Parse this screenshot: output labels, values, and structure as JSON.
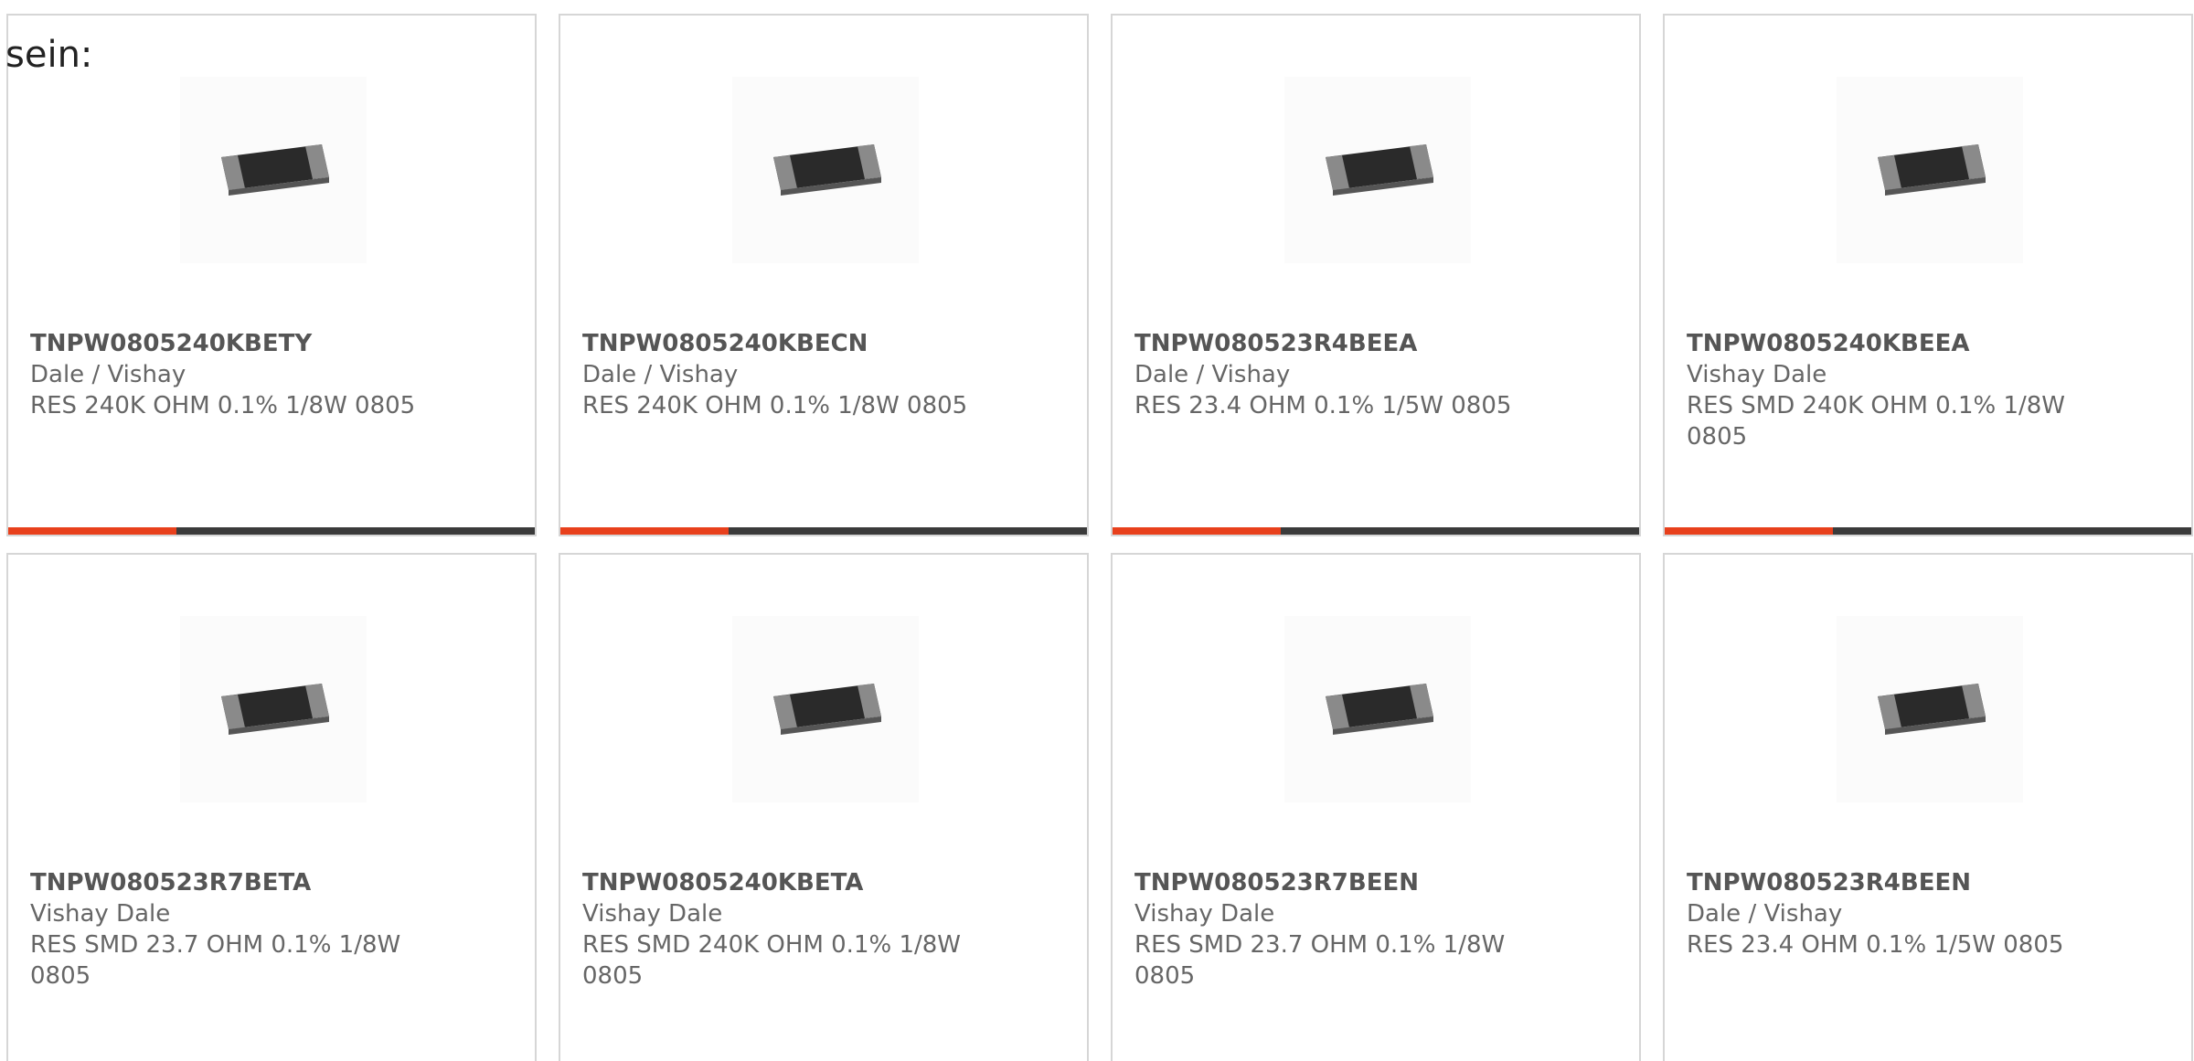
{
  "intro_text": "sein:",
  "colors": {
    "accent": "#e8401c",
    "bar_track": "#3b3b3b",
    "card_border": "#d6d6d6",
    "text_part": "#555555",
    "text_meta": "#666666"
  },
  "products": [
    {
      "part": "TNPW0805240KBETY",
      "manufacturer": "Dale / Vishay",
      "description": "RES 240K OHM 0.1% 1/8W 0805",
      "image_icon": "smd-resistor-chip-icon",
      "bar_fill": 0.32
    },
    {
      "part": "TNPW0805240KBECN",
      "manufacturer": "Dale / Vishay",
      "description": "RES 240K OHM 0.1% 1/8W 0805",
      "image_icon": "smd-resistor-chip-icon",
      "bar_fill": 0.32
    },
    {
      "part": "TNPW080523R4BEEA",
      "manufacturer": "Dale / Vishay",
      "description": "RES 23.4 OHM 0.1% 1/5W 0805",
      "image_icon": "smd-resistor-chip-icon",
      "bar_fill": 0.32
    },
    {
      "part": "TNPW0805240KBEEA",
      "manufacturer": "Vishay Dale",
      "description": "RES SMD 240K OHM 0.1% 1/8W 0805",
      "image_icon": "smd-resistor-chip-icon",
      "bar_fill": 0.32
    },
    {
      "part": "TNPW080523R7BETA",
      "manufacturer": "Vishay Dale",
      "description": "RES SMD 23.7 OHM 0.1% 1/8W 0805",
      "image_icon": "smd-resistor-chip-icon"
    },
    {
      "part": "TNPW0805240KBETA",
      "manufacturer": "Vishay Dale",
      "description": "RES SMD 240K OHM 0.1% 1/8W 0805",
      "image_icon": "smd-resistor-chip-icon"
    },
    {
      "part": "TNPW080523R7BEEN",
      "manufacturer": "Vishay Dale",
      "description": "RES SMD 23.7 OHM 0.1% 1/8W 0805",
      "image_icon": "smd-resistor-chip-icon"
    },
    {
      "part": "TNPW080523R4BEEN",
      "manufacturer": "Dale / Vishay",
      "description": "RES 23.4 OHM 0.1% 1/5W 0805",
      "image_icon": "smd-resistor-chip-icon"
    }
  ]
}
